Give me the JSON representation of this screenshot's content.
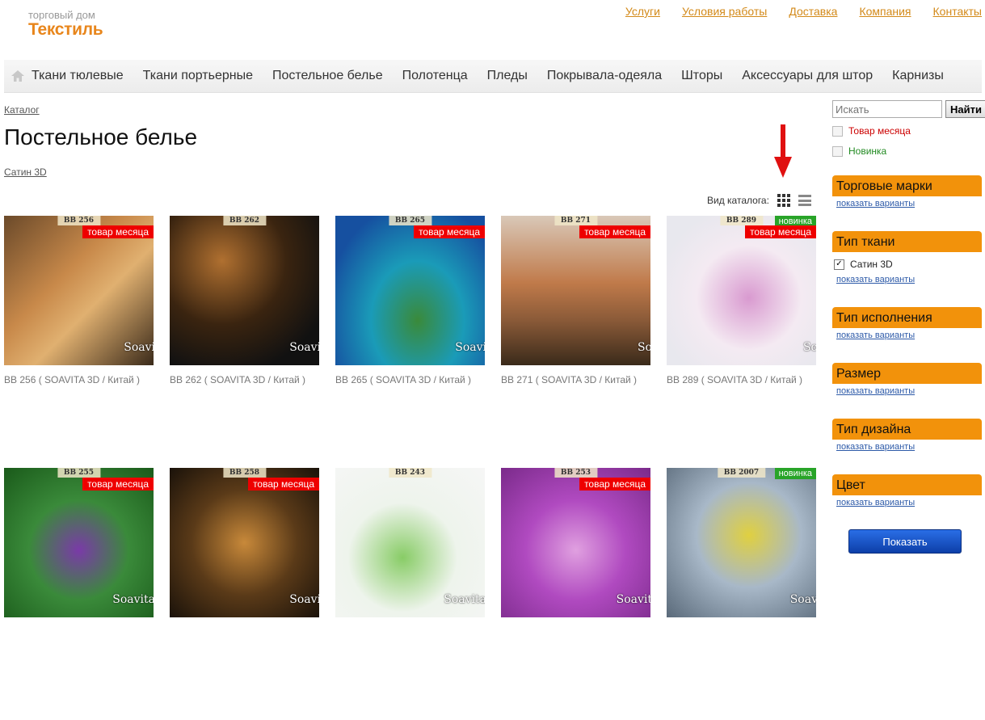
{
  "logo": {
    "small": "торговый дом",
    "big": "Текстиль"
  },
  "top_links": [
    "Услуги",
    "Условия работы",
    "Доставка",
    "Компания",
    "Контакты"
  ],
  "nav": [
    "Ткани тюлевые",
    "Ткани портьерные",
    "Постельное белье",
    "Полотенца",
    "Пледы",
    "Покрывала-одеяла",
    "Шторы",
    "Аксессуары для штор",
    "Карнизы"
  ],
  "breadcrumb": "Каталог",
  "page_title": "Постельное белье",
  "subcategory": "Сатин 3D",
  "view_label": "Вид каталога:",
  "products": [
    {
      "code": "BB 256",
      "caption": "BB 256 ( SOAVITA 3D / Китай )",
      "badge": "товар месяца",
      "brand": "Soavi",
      "bg": "linear-gradient(135deg,#6b4a2a,#c8894a 40%,#e0b070 60%,#3a2a1a)"
    },
    {
      "code": "BB 262",
      "caption": "BB 262 ( SOAVITA 3D / Китай )",
      "badge": "",
      "brand": "Soavi",
      "bg": "radial-gradient(circle at 35% 30%,#b07030,#3a2410 45%,#111 80%)"
    },
    {
      "code": "BB 265",
      "caption": "BB 265 ( SOAVITA 3D / Китай )",
      "badge": "товар месяца",
      "brand": "Soavi",
      "bg": "radial-gradient(ellipse at 55% 70%,#3a8a3a,#1a9bb8 40%,#1650a0 80%)"
    },
    {
      "code": "BB 271",
      "caption": "BB 271 ( SOAVITA 3D / Китай )",
      "badge": "товар месяца",
      "brand": "So",
      "bg": "linear-gradient(180deg,#d9c8b8,#c07a4a 45%,#8a5a38 70%,#3a2a1a)"
    },
    {
      "code": "BB 289",
      "caption": "BB 289 ( SOAVITA 3D / Китай )",
      "badge": "товар месяца",
      "new": "новинка",
      "brand": "So",
      "bg": "radial-gradient(circle at 55% 55%,#d99ad0,#f4eaf2 45%,#e8e8ee 80%)"
    },
    {
      "code": "BB 255",
      "caption": "",
      "badge": "товар месяца",
      "brand": "Soavita",
      "bg": "radial-gradient(circle at 50% 55%,#7a3aa8,#3a8a3a 45%,#1a5a1a)"
    },
    {
      "code": "BB 258",
      "caption": "",
      "badge": "товар месяца",
      "brand": "Soavi",
      "bg": "radial-gradient(circle at 50% 50%,#c8893a,#5a3a18 50%,#1a120a)"
    },
    {
      "code": "BB 243",
      "caption": "",
      "badge": "",
      "brand": "Soavita",
      "bg": "radial-gradient(circle at 45% 60%,#88cc66,#eef4ec 45%,#f6f6f6)"
    },
    {
      "code": "BB 253",
      "caption": "",
      "badge": "товар месяца",
      "brand": "Soavit",
      "bg": "radial-gradient(circle at 50% 55%,#e0a0e0,#b04ac0 45%,#7a2a8a)"
    },
    {
      "code": "BB 2007",
      "caption": "",
      "badge": "",
      "new": "новинка",
      "brand": "Soav",
      "bg": "radial-gradient(circle at 55% 45%,#e0d040,#a8b8c8 45%,#5a6a7a)"
    }
  ],
  "sidebar": {
    "search_placeholder": "Искать",
    "search_button": "Найти",
    "month_item": "Товар месяца",
    "new_item": "Новинка",
    "filters": [
      {
        "title": "Торговые марки",
        "link": "показать варианты"
      },
      {
        "title": "Тип ткани",
        "option": "Сатин 3D",
        "link": "показать варианты"
      },
      {
        "title": "Тип исполнения",
        "link": "показать варианты"
      },
      {
        "title": "Размер",
        "link": "показать варианты"
      },
      {
        "title": "Тип дизайна",
        "link": "показать варианты"
      },
      {
        "title": "Цвет",
        "link": "показать варианты"
      }
    ],
    "show_button": "Показать"
  },
  "colors": {
    "accent": "#f2920b",
    "logo": "#e8861c",
    "badge_red": "#ee0000",
    "badge_green": "#28a428",
    "button_blue": "#0d3fa8"
  }
}
